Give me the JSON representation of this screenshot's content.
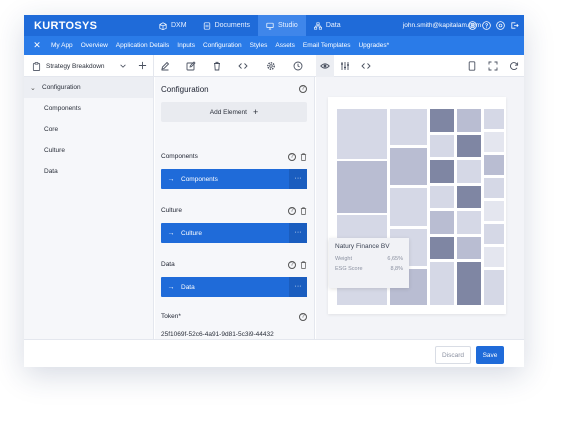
{
  "app": {
    "logo": "KURTOSYS"
  },
  "topnav": {
    "tabs": [
      {
        "label": "DXM",
        "icon": "box-icon"
      },
      {
        "label": "Documents",
        "icon": "document-icon"
      },
      {
        "label": "Studio",
        "icon": "monitor-icon"
      },
      {
        "label": "Data",
        "icon": "hierarchy-icon"
      }
    ],
    "active_tab": "Studio",
    "user_email": "john.smith@kapitalam.com"
  },
  "secondary_nav": {
    "items": [
      "My App",
      "Overview",
      "Application Details",
      "Inputs",
      "Configuration",
      "Styles",
      "Assets",
      "Email Templates",
      "Upgrades*"
    ]
  },
  "toolbar": {
    "page_selector": "Strategy Breakdown"
  },
  "sidebar": {
    "items": [
      {
        "label": "Configuration",
        "expanded": true
      },
      {
        "label": "Components"
      },
      {
        "label": "Core"
      },
      {
        "label": "Culture"
      },
      {
        "label": "Data"
      }
    ]
  },
  "config_panel": {
    "title": "Configuration",
    "add_element_label": "Add Element",
    "groups": [
      {
        "title": "Components",
        "item": "Components"
      },
      {
        "title": "Culture",
        "item": "Culture"
      },
      {
        "title": "Data",
        "item": "Data"
      }
    ],
    "token_label": "Token*",
    "token_value": "25f1069f-52c6-4a91-9d81-5c3i9-44432"
  },
  "preview": {
    "tooltip": {
      "title": "Natury Finance BV",
      "rows": [
        {
          "label": "Weight",
          "value": "6,65%"
        },
        {
          "label": "ESG Score",
          "value": "8,8%"
        }
      ]
    }
  },
  "footer": {
    "discard_label": "Discard",
    "save_label": "Save"
  },
  "colors": {
    "primary": "#1f6bd9",
    "secondary_nav": "#2a7be8",
    "tile_light": "#d5d8e6",
    "tile_mid": "#b9bdd2",
    "tile_dark": "#7f86a3"
  }
}
